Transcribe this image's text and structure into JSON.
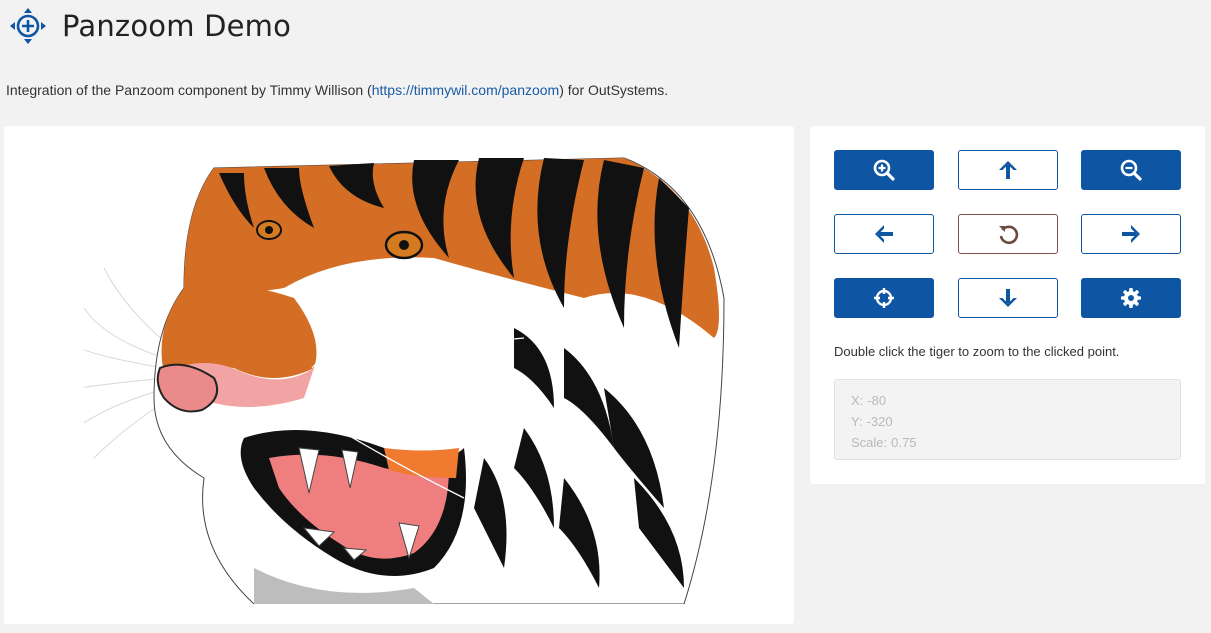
{
  "header": {
    "title": "Panzoom Demo",
    "logo_icon": "move-arrows-icon"
  },
  "intro": {
    "text_before": "Integration of the Panzoom component by Timmy Willison (",
    "link_text": "https://timmywil.com/panzoom",
    "text_after": ") for OutSystems."
  },
  "canvas": {
    "image": "tiger-illustration"
  },
  "controls": {
    "buttons": [
      {
        "name": "zoom-in",
        "icon": "zoom-in-icon",
        "style": "filled"
      },
      {
        "name": "pan-up",
        "icon": "arrow-up-icon",
        "style": "outline"
      },
      {
        "name": "zoom-out",
        "icon": "zoom-out-icon",
        "style": "filled"
      },
      {
        "name": "pan-left",
        "icon": "arrow-left-icon",
        "style": "outline"
      },
      {
        "name": "reset",
        "icon": "reset-icon",
        "style": "outline"
      },
      {
        "name": "pan-right",
        "icon": "arrow-right-icon",
        "style": "outline"
      },
      {
        "name": "center",
        "icon": "crosshair-icon",
        "style": "filled"
      },
      {
        "name": "pan-down",
        "icon": "arrow-down-icon",
        "style": "outline"
      },
      {
        "name": "settings",
        "icon": "gear-icon",
        "style": "filled"
      }
    ],
    "hint": "Double click the tiger to zoom to the clicked point.",
    "readout": {
      "x_label": "X:",
      "x_value": "-80",
      "y_label": "Y:",
      "y_value": "-320",
      "scale_label": "Scale:",
      "scale_value": "0.75"
    }
  },
  "colors": {
    "primary": "#0e56a4",
    "reset_border": "#7a5048",
    "link": "#1a5aa6"
  }
}
